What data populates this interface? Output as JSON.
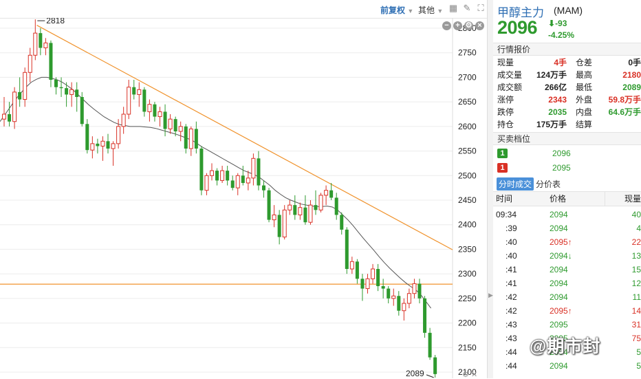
{
  "toolbar": {
    "adjust_label": "前复权",
    "other_label": "其他",
    "icons": [
      "grid-icon",
      "draw-icon",
      "fullscreen-icon"
    ]
  },
  "chart_panel": {
    "controls": [
      "minus-icon",
      "plus-icon",
      "gear-icon",
      "close-icon"
    ]
  },
  "chart_data": {
    "type": "candlestick",
    "y_ticks": [
      2800,
      2750,
      2700,
      2650,
      2600,
      2550,
      2500,
      2450,
      2400,
      2350,
      2300,
      2250,
      2200,
      2150,
      2100
    ],
    "ylim": [
      2093,
      2821
    ],
    "high_annotation": "2818",
    "low_annotation": "2089",
    "horizontal_line": 2279,
    "trend_line": {
      "from": [
        1,
        2806
      ],
      "to": [
        91,
        2349
      ]
    },
    "colors": {
      "up": "#d93025",
      "down": "#2e9a2e",
      "trend": "#f0922b",
      "hline": "#f0922b",
      "ma": "#555555"
    },
    "candles": [
      [
        2615,
        2660,
        2600,
        2625
      ],
      [
        2625,
        2650,
        2600,
        2610
      ],
      [
        2610,
        2680,
        2595,
        2670
      ],
      [
        2670,
        2700,
        2640,
        2655
      ],
      [
        2655,
        2720,
        2640,
        2710
      ],
      [
        2710,
        2760,
        2690,
        2745
      ],
      [
        2745,
        2818,
        2735,
        2790
      ],
      [
        2790,
        2800,
        2745,
        2760
      ],
      [
        2760,
        2780,
        2745,
        2770
      ],
      [
        2770,
        2775,
        2680,
        2695
      ],
      [
        2695,
        2700,
        2665,
        2680
      ],
      [
        2680,
        2700,
        2660,
        2678
      ],
      [
        2678,
        2690,
        2640,
        2665
      ],
      [
        2665,
        2690,
        2640,
        2675
      ],
      [
        2675,
        2690,
        2630,
        2660
      ],
      [
        2660,
        2670,
        2600,
        2605
      ],
      [
        2605,
        2615,
        2545,
        2552
      ],
      [
        2552,
        2580,
        2535,
        2565
      ],
      [
        2565,
        2575,
        2545,
        2560
      ],
      [
        2560,
        2580,
        2530,
        2570
      ],
      [
        2570,
        2585,
        2545,
        2555
      ],
      [
        2555,
        2570,
        2520,
        2565
      ],
      [
        2565,
        2615,
        2555,
        2600
      ],
      [
        2600,
        2640,
        2585,
        2625
      ],
      [
        2625,
        2695,
        2615,
        2680
      ],
      [
        2680,
        2695,
        2655,
        2665
      ],
      [
        2665,
        2690,
        2640,
        2675
      ],
      [
        2675,
        2680,
        2620,
        2630
      ],
      [
        2630,
        2655,
        2610,
        2645
      ],
      [
        2645,
        2650,
        2610,
        2620
      ],
      [
        2620,
        2640,
        2600,
        2630
      ],
      [
        2630,
        2645,
        2580,
        2595
      ],
      [
        2595,
        2625,
        2585,
        2615
      ],
      [
        2615,
        2620,
        2580,
        2590
      ],
      [
        2590,
        2610,
        2570,
        2600
      ],
      [
        2600,
        2605,
        2545,
        2555
      ],
      [
        2555,
        2600,
        2540,
        2595
      ],
      [
        2595,
        2610,
        2545,
        2555
      ],
      [
        2555,
        2560,
        2460,
        2470
      ],
      [
        2470,
        2505,
        2460,
        2500
      ],
      [
        2500,
        2525,
        2490,
        2510
      ],
      [
        2510,
        2515,
        2480,
        2490
      ],
      [
        2490,
        2520,
        2485,
        2510
      ],
      [
        2510,
        2520,
        2480,
        2490
      ],
      [
        2490,
        2500,
        2470,
        2475
      ],
      [
        2475,
        2505,
        2460,
        2500
      ],
      [
        2500,
        2520,
        2480,
        2485
      ],
      [
        2485,
        2510,
        2470,
        2495
      ],
      [
        2495,
        2545,
        2480,
        2535
      ],
      [
        2535,
        2550,
        2470,
        2480
      ],
      [
        2480,
        2490,
        2455,
        2470
      ],
      [
        2470,
        2475,
        2405,
        2410
      ],
      [
        2410,
        2440,
        2395,
        2420
      ],
      [
        2420,
        2430,
        2360,
        2375
      ],
      [
        2375,
        2440,
        2370,
        2430
      ],
      [
        2430,
        2450,
        2420,
        2440
      ],
      [
        2440,
        2460,
        2410,
        2420
      ],
      [
        2420,
        2445,
        2410,
        2435
      ],
      [
        2435,
        2460,
        2400,
        2405
      ],
      [
        2405,
        2450,
        2400,
        2440
      ],
      [
        2440,
        2470,
        2420,
        2430
      ],
      [
        2430,
        2465,
        2425,
        2460
      ],
      [
        2460,
        2480,
        2440,
        2470
      ],
      [
        2470,
        2485,
        2450,
        2455
      ],
      [
        2455,
        2465,
        2410,
        2420
      ],
      [
        2420,
        2425,
        2380,
        2390
      ],
      [
        2390,
        2395,
        2300,
        2310
      ],
      [
        2310,
        2335,
        2300,
        2325
      ],
      [
        2325,
        2330,
        2280,
        2290
      ],
      [
        2290,
        2300,
        2245,
        2270
      ],
      [
        2270,
        2300,
        2260,
        2290
      ],
      [
        2290,
        2320,
        2280,
        2310
      ],
      [
        2310,
        2320,
        2265,
        2275
      ],
      [
        2275,
        2290,
        2250,
        2270
      ],
      [
        2270,
        2275,
        2240,
        2250
      ],
      [
        2250,
        2270,
        2235,
        2255
      ],
      [
        2255,
        2265,
        2215,
        2225
      ],
      [
        2225,
        2250,
        2205,
        2240
      ],
      [
        2240,
        2270,
        2230,
        2260
      ],
      [
        2260,
        2290,
        2250,
        2280
      ],
      [
        2280,
        2290,
        2240,
        2250
      ],
      [
        2250,
        2255,
        2170,
        2180
      ],
      [
        2180,
        2190,
        2125,
        2130
      ],
      [
        2130,
        2135,
        2089,
        2096
      ]
    ],
    "ma": [
      2610,
      2625,
      2640,
      2655,
      2668,
      2680,
      2690,
      2696,
      2700,
      2700,
      2698,
      2695,
      2690,
      2683,
      2675,
      2665,
      2655,
      2645,
      2636,
      2628,
      2620,
      2614,
      2608,
      2604,
      2602,
      2600,
      2600,
      2600,
      2599,
      2598,
      2596,
      2593,
      2590,
      2587,
      2584,
      2580,
      2576,
      2572,
      2565,
      2558,
      2552,
      2546,
      2540,
      2534,
      2528,
      2522,
      2516,
      2510,
      2506,
      2502,
      2496,
      2488,
      2480,
      2470,
      2462,
      2455,
      2450,
      2446,
      2442,
      2440,
      2438,
      2437,
      2437,
      2438,
      2436,
      2430,
      2420,
      2410,
      2398,
      2385,
      2372,
      2360,
      2348,
      2335,
      2323,
      2312,
      2302,
      2292,
      2283,
      2275,
      2268,
      2258,
      2244,
      2230
    ]
  },
  "quote": {
    "name": "甲醇主力",
    "code": "(MAM)",
    "price": "2096",
    "change": "-93",
    "change_pct": "-4.25%",
    "section_quote": "行情报价",
    "rows": [
      {
        "l1": "现量",
        "v1": "4手",
        "c1": "red",
        "l2": "仓差",
        "v2": "0手",
        "c2": "blk"
      },
      {
        "l1": "成交量",
        "v1": "124万手",
        "c1": "blk",
        "l2": "最高",
        "v2": "2180",
        "c2": "red"
      },
      {
        "l1": "成交额",
        "v1": "266亿",
        "c1": "blk",
        "l2": "最低",
        "v2": "2089",
        "c2": "green"
      },
      {
        "l1": "涨停",
        "v1": "2343",
        "c1": "red",
        "l2": "外盘",
        "v2": "59.8万手",
        "c2": "red"
      },
      {
        "l1": "跌停",
        "v1": "2035",
        "c1": "green",
        "l2": "内盘",
        "v2": "64.6万手",
        "c2": "green"
      },
      {
        "l1": "持仓",
        "v1": "175万手",
        "c1": "blk",
        "l2": "结算",
        "v2": "",
        "c2": "blk"
      }
    ],
    "section_book": "买卖档位",
    "book": [
      {
        "level": "1",
        "price": "2096",
        "side": "sell"
      },
      {
        "level": "1",
        "price": "2095",
        "side": "buy"
      }
    ],
    "tab_active": "分时成交",
    "tab_other": "分价表",
    "tick_headers": {
      "time": "时间",
      "price": "价格",
      "volume": "现量"
    },
    "ticks": [
      {
        "time": "09:34",
        "price": "2094",
        "arrow": "",
        "pc": "green",
        "vol": "40",
        "vc": "green"
      },
      {
        "time": ":39",
        "price": "2094",
        "arrow": "",
        "pc": "green",
        "vol": "4",
        "vc": "green"
      },
      {
        "time": ":40",
        "price": "2095",
        "arrow": "↑",
        "pc": "red",
        "vol": "22",
        "vc": "red"
      },
      {
        "time": ":40",
        "price": "2094",
        "arrow": "↓",
        "pc": "green",
        "vol": "13",
        "vc": "green"
      },
      {
        "time": ":41",
        "price": "2094",
        "arrow": "",
        "pc": "green",
        "vol": "15",
        "vc": "green"
      },
      {
        "time": ":41",
        "price": "2094",
        "arrow": "",
        "pc": "green",
        "vol": "12",
        "vc": "green"
      },
      {
        "time": ":42",
        "price": "2094",
        "arrow": "",
        "pc": "green",
        "vol": "11",
        "vc": "green"
      },
      {
        "time": ":42",
        "price": "2095",
        "arrow": "↑",
        "pc": "red",
        "vol": "14",
        "vc": "red"
      },
      {
        "time": ":43",
        "price": "2095",
        "arrow": "",
        "pc": "green",
        "vol": "31",
        "vc": "red"
      },
      {
        "time": ":43",
        "price": "2095",
        "arrow": "",
        "pc": "green",
        "vol": "75",
        "vc": "red"
      },
      {
        "time": ":44",
        "price": "2094",
        "arrow": "",
        "pc": "green",
        "vol": "5",
        "vc": "green"
      },
      {
        "time": ":44",
        "price": "2094",
        "arrow": "",
        "pc": "green",
        "vol": "5",
        "vc": "green"
      }
    ]
  },
  "watermark": "@期市封"
}
